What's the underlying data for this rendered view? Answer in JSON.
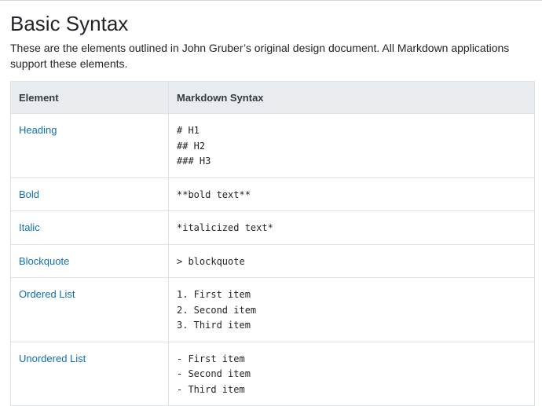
{
  "heading": "Basic Syntax",
  "intro": "These are the elements outlined in John Gruber’s original design document. All Markdown applications support these elements.",
  "table": {
    "headers": [
      "Element",
      "Markdown Syntax"
    ],
    "rows": [
      {
        "element": "Heading",
        "syntax": [
          "# H1",
          "## H2",
          "### H3"
        ]
      },
      {
        "element": "Bold",
        "syntax": [
          "**bold text**"
        ]
      },
      {
        "element": "Italic",
        "syntax": [
          "*italicized text*"
        ]
      },
      {
        "element": "Blockquote",
        "syntax": [
          "> blockquote"
        ]
      },
      {
        "element": "Ordered List",
        "syntax": [
          "1. First item",
          "2. Second item",
          "3. Third item"
        ]
      },
      {
        "element": "Unordered List",
        "syntax": [
          "- First item",
          "- Second item",
          "- Third item"
        ]
      }
    ]
  },
  "colors": {
    "link": "#0e6fb3",
    "header_bg": "#e9ecef",
    "border": "#dee2e6"
  }
}
